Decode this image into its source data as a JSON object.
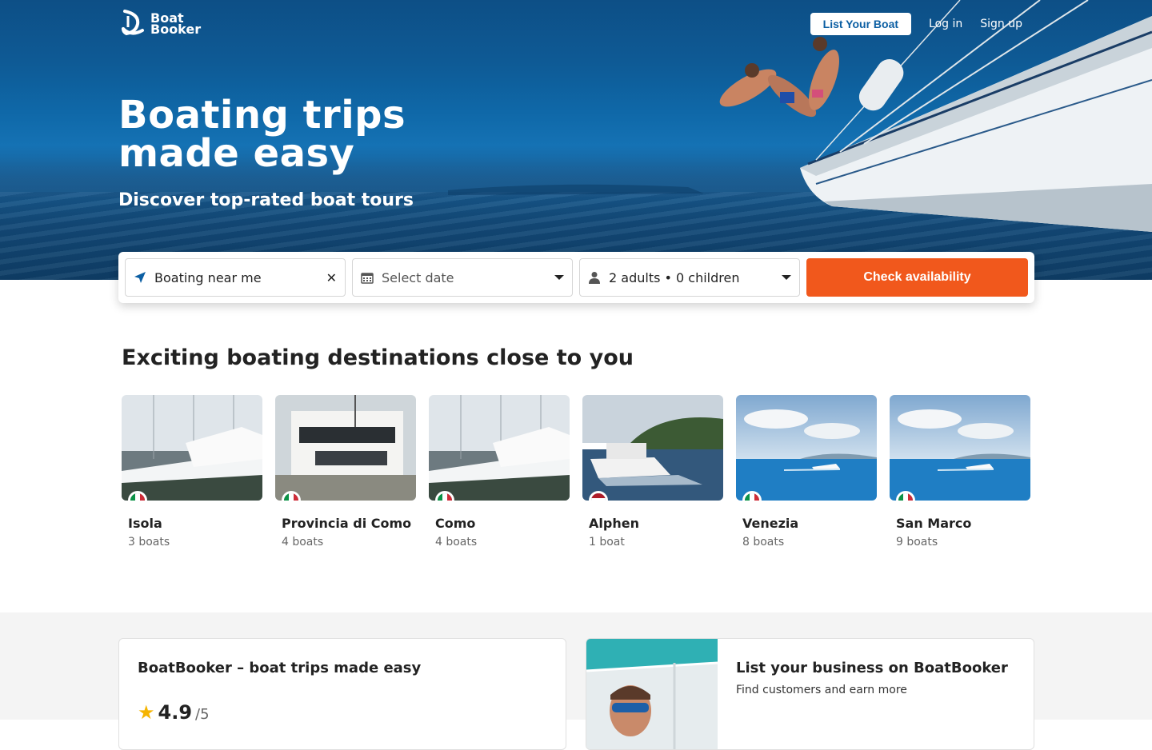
{
  "brand": {
    "name_line1": "Boat",
    "name_line2": "Booker"
  },
  "nav": {
    "list_your_boat": "List Your Boat",
    "log_in": "Log in",
    "sign_up": "Sign up"
  },
  "hero": {
    "title_line1": "Boating trips",
    "title_line2": "made easy",
    "subtitle": "Discover top-rated boat tours"
  },
  "search": {
    "location_value": "Boating near me",
    "date_placeholder": "Select date",
    "guests_value": "2 adults • 0 children",
    "check_label": "Check availability"
  },
  "destinations": {
    "title": "Exciting boating destinations close to you",
    "items": [
      {
        "name": "Isola",
        "count": "3 boats",
        "flag": "it"
      },
      {
        "name": "Provincia di Como",
        "count": "4 boats",
        "flag": "it"
      },
      {
        "name": "Como",
        "count": "4 boats",
        "flag": "it"
      },
      {
        "name": "Alphen",
        "count": "1 boat",
        "flag": "nl"
      },
      {
        "name": "Venezia",
        "count": "8 boats",
        "flag": "it"
      },
      {
        "name": "San Marco",
        "count": "9 boats",
        "flag": "it"
      }
    ]
  },
  "cards": {
    "about_title": "BoatBooker – boat trips made easy",
    "rating_value": "4.9",
    "rating_max": "/5",
    "business_title": "List your business on BoatBooker",
    "business_sub": "Find customers and earn more"
  },
  "colors": {
    "accent": "#f1581c",
    "brand_blue": "#0c5fa3",
    "star": "#f5b400"
  }
}
